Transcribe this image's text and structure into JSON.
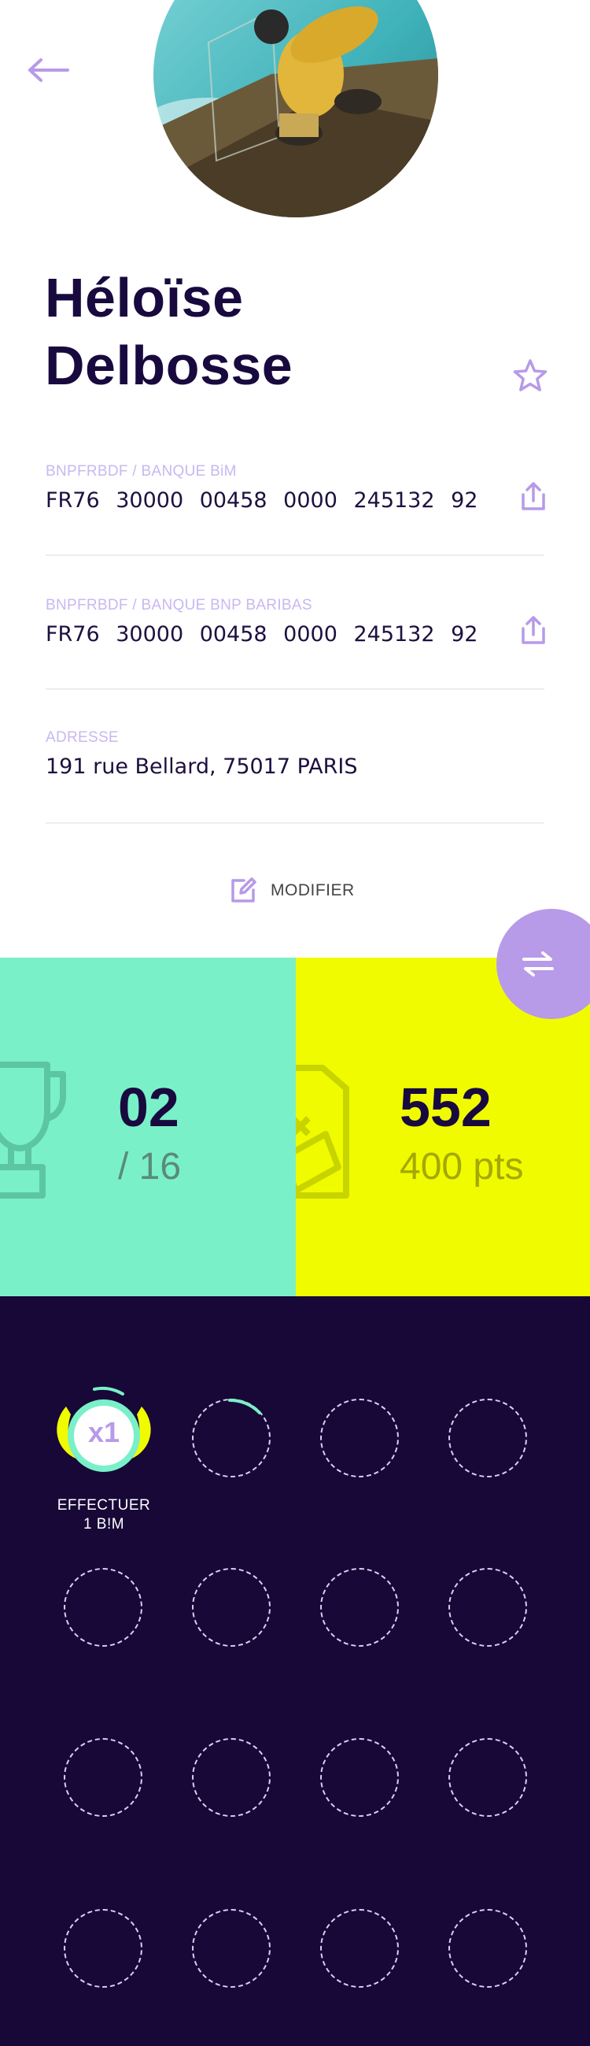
{
  "profile": {
    "first_name": "Héloïse",
    "last_name": "Delbosse"
  },
  "accounts": [
    {
      "label": "BNPFRBDF / BANQUE BiM",
      "iban": "FR76 30000 00458 0000 245132 92"
    },
    {
      "label": "BNPFRBDF / BANQUE BNP BARIBAS",
      "iban": "FR76 30000 00458 0000 245132 92"
    }
  ],
  "address": {
    "label": "ADRESSE",
    "value": "191 rue Bellard, 75017 PARIS"
  },
  "edit_label": "MODIFIER",
  "stats": {
    "challenges_done": "02",
    "challenges_total": "/ 16",
    "points": "552",
    "points_total": "400 pts"
  },
  "badges": {
    "active_badge_text": "x1",
    "active_caption_line1": "EFFECTUER",
    "active_caption_line2": "1 B!M"
  },
  "colors": {
    "primary_dark": "#180a3f",
    "accent_purple": "#b79ae8",
    "mint": "#7af0c8",
    "yellow": "#f0fb00",
    "badge_bg": "#170838"
  }
}
